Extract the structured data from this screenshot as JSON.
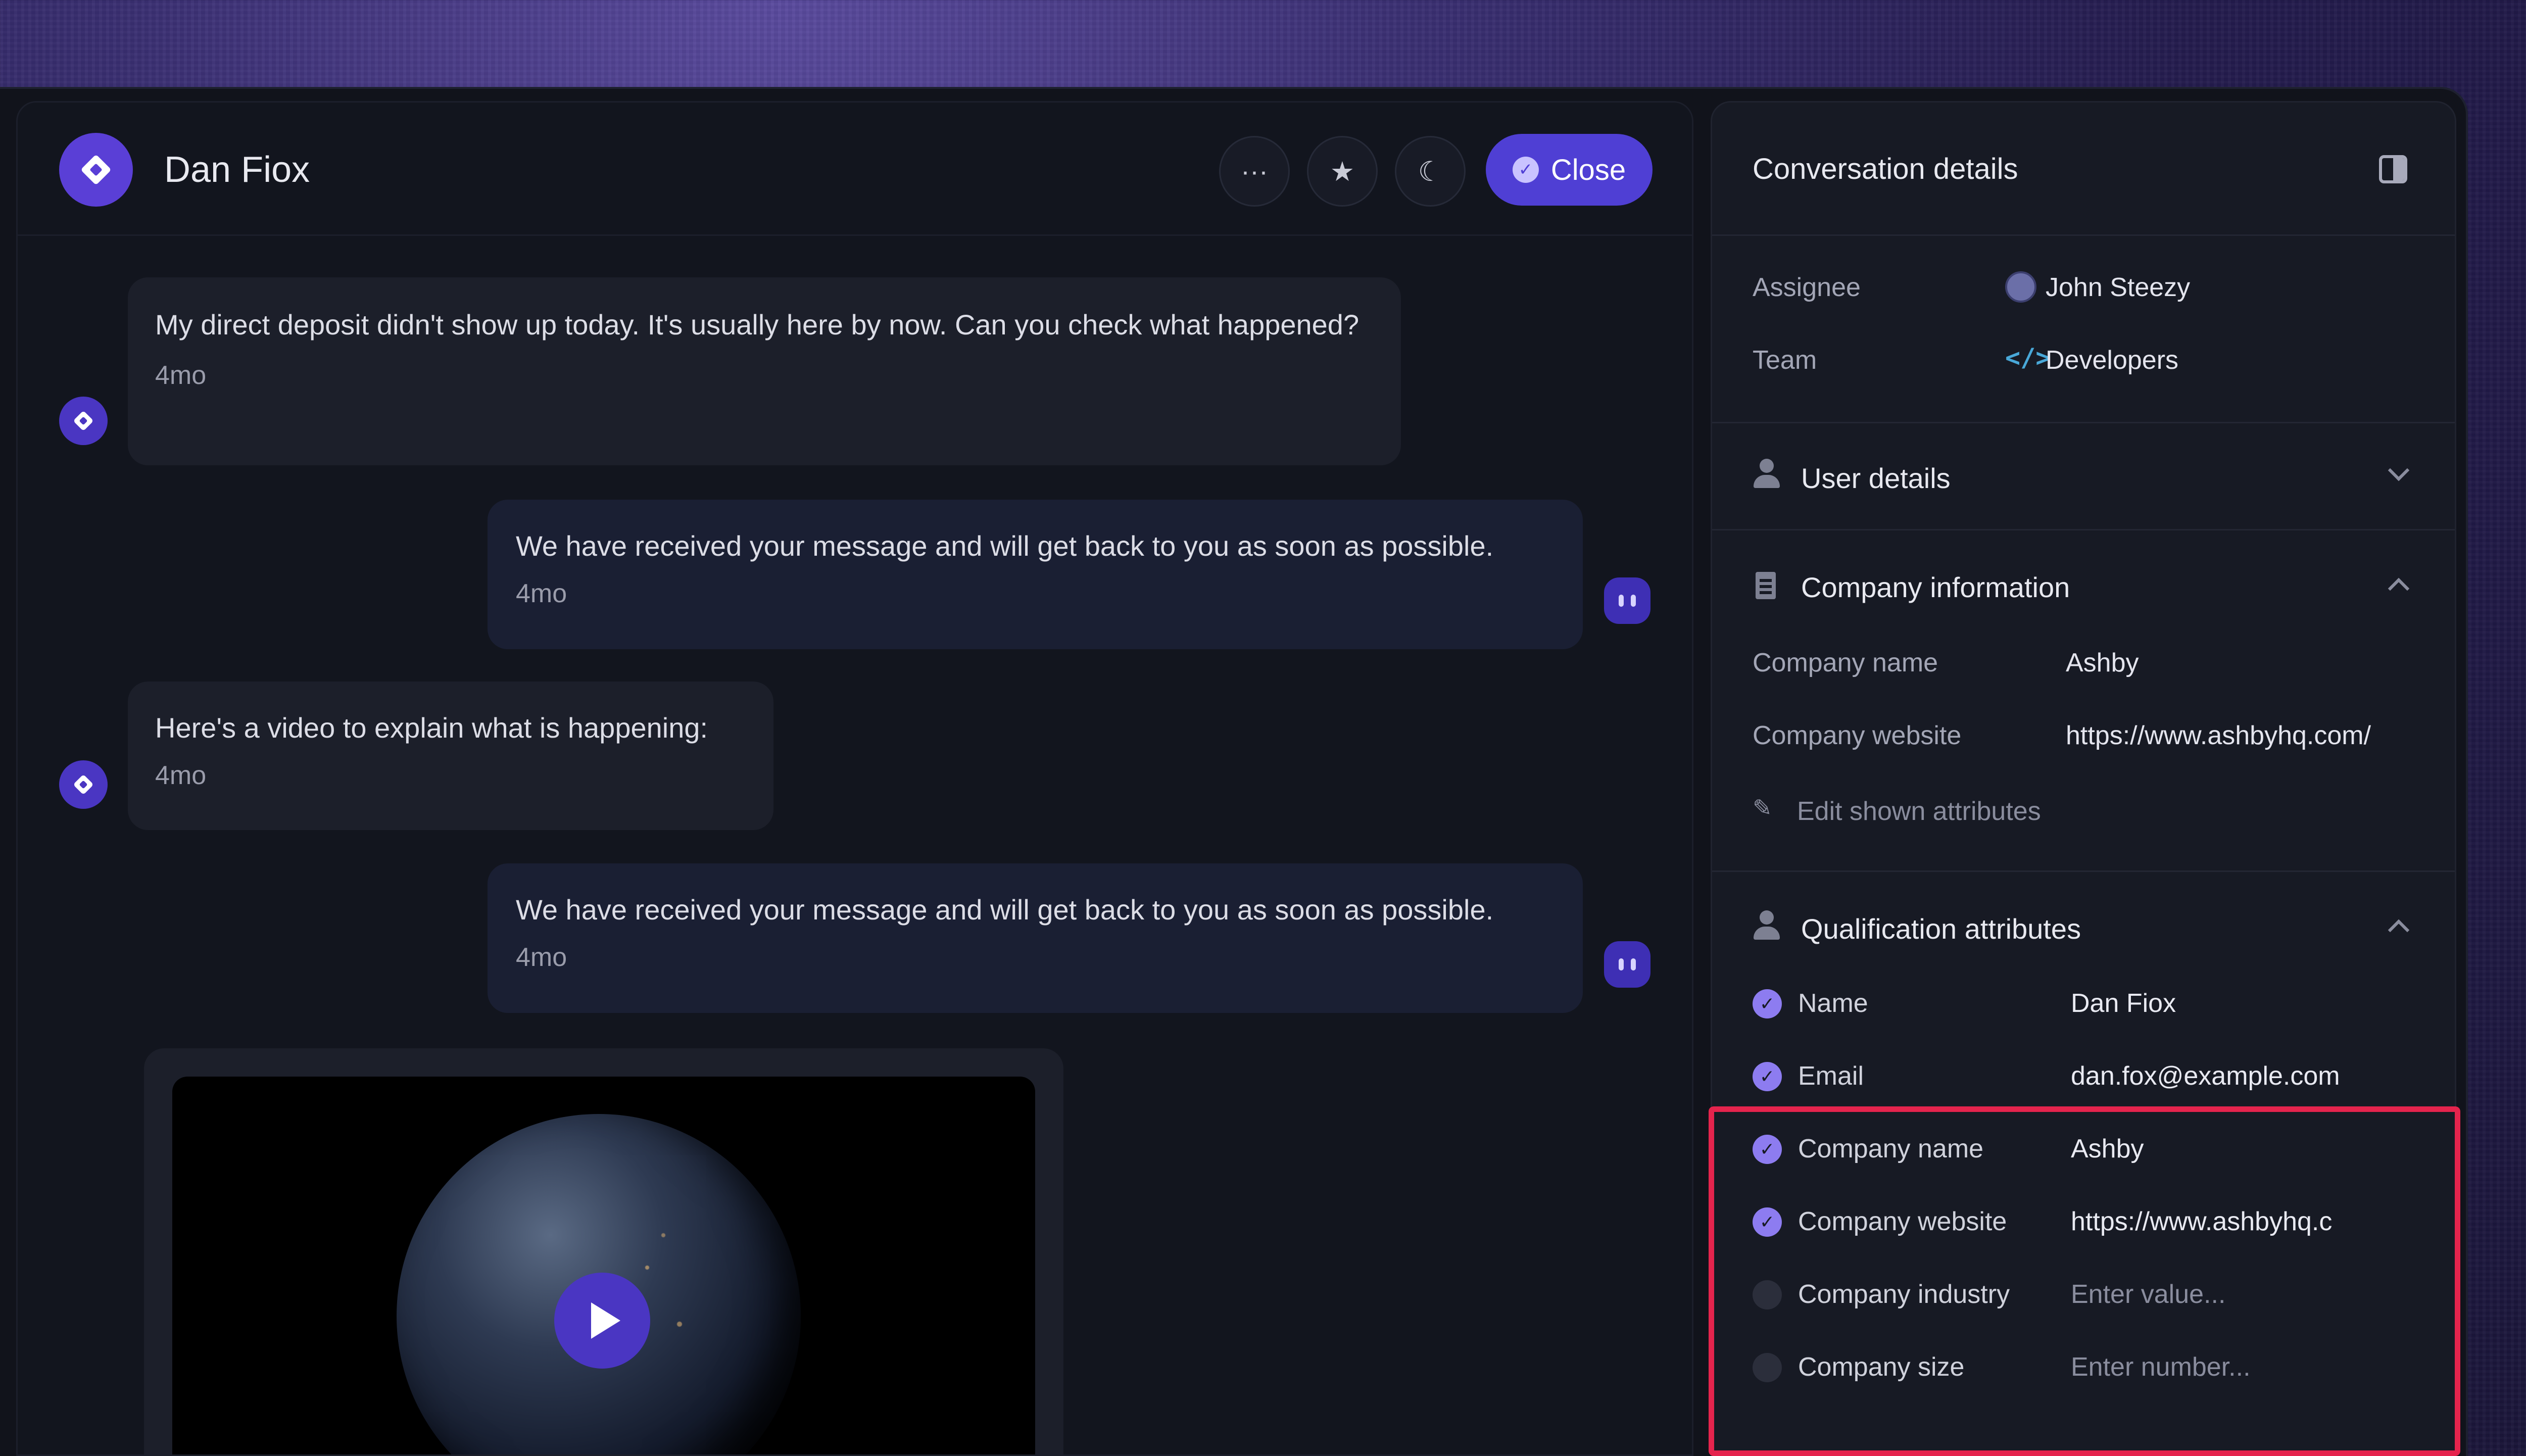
{
  "chat": {
    "contact_name": "Dan Fiox",
    "actions": {
      "more": "···",
      "star": "★",
      "snooze": "☾",
      "close_label": "Close"
    },
    "messages": [
      {
        "direction": "in",
        "text": "My direct deposit didn't show up today. It's usually here by now. Can you check what happened?",
        "time": "4mo"
      },
      {
        "direction": "out",
        "text": "We have received your message and will get back to you as soon as possible.",
        "time": "4mo"
      },
      {
        "direction": "in",
        "text": "Here's a video to explain what is happening:",
        "time": "4mo"
      },
      {
        "direction": "out",
        "text": "We have received your message and will get back to you as soon as possible.",
        "time": "4mo"
      }
    ]
  },
  "details": {
    "title": "Conversation details",
    "assignee_label": "Assignee",
    "assignee_value": "John Steezy",
    "team_label": "Team",
    "team_value": "Developers",
    "team_icon": "</>",
    "user_details": "User details",
    "company_info": {
      "title": "Company information",
      "name_label": "Company name",
      "name_value": "Ashby",
      "website_label": "Company website",
      "website_value": "https://www.ashbyhq.com/",
      "edit_label": "Edit shown attributes"
    },
    "qualification": {
      "title": "Qualification attributes",
      "items": [
        {
          "label": "Name",
          "value": "Dan Fiox",
          "filled": true
        },
        {
          "label": "Email",
          "value": "dan.fox@example.com",
          "filled": true
        },
        {
          "label": "Company name",
          "value": "Ashby",
          "filled": true
        },
        {
          "label": "Company website",
          "value": "https://www.ashbyhq.c",
          "filled": true
        },
        {
          "label": "Company industry",
          "value": "Enter value...",
          "filled": false
        },
        {
          "label": "Company size",
          "value": "Enter number...",
          "filled": false
        }
      ]
    }
  },
  "colors": {
    "accent": "#4f3fd4",
    "highlight": "#e5244d"
  }
}
